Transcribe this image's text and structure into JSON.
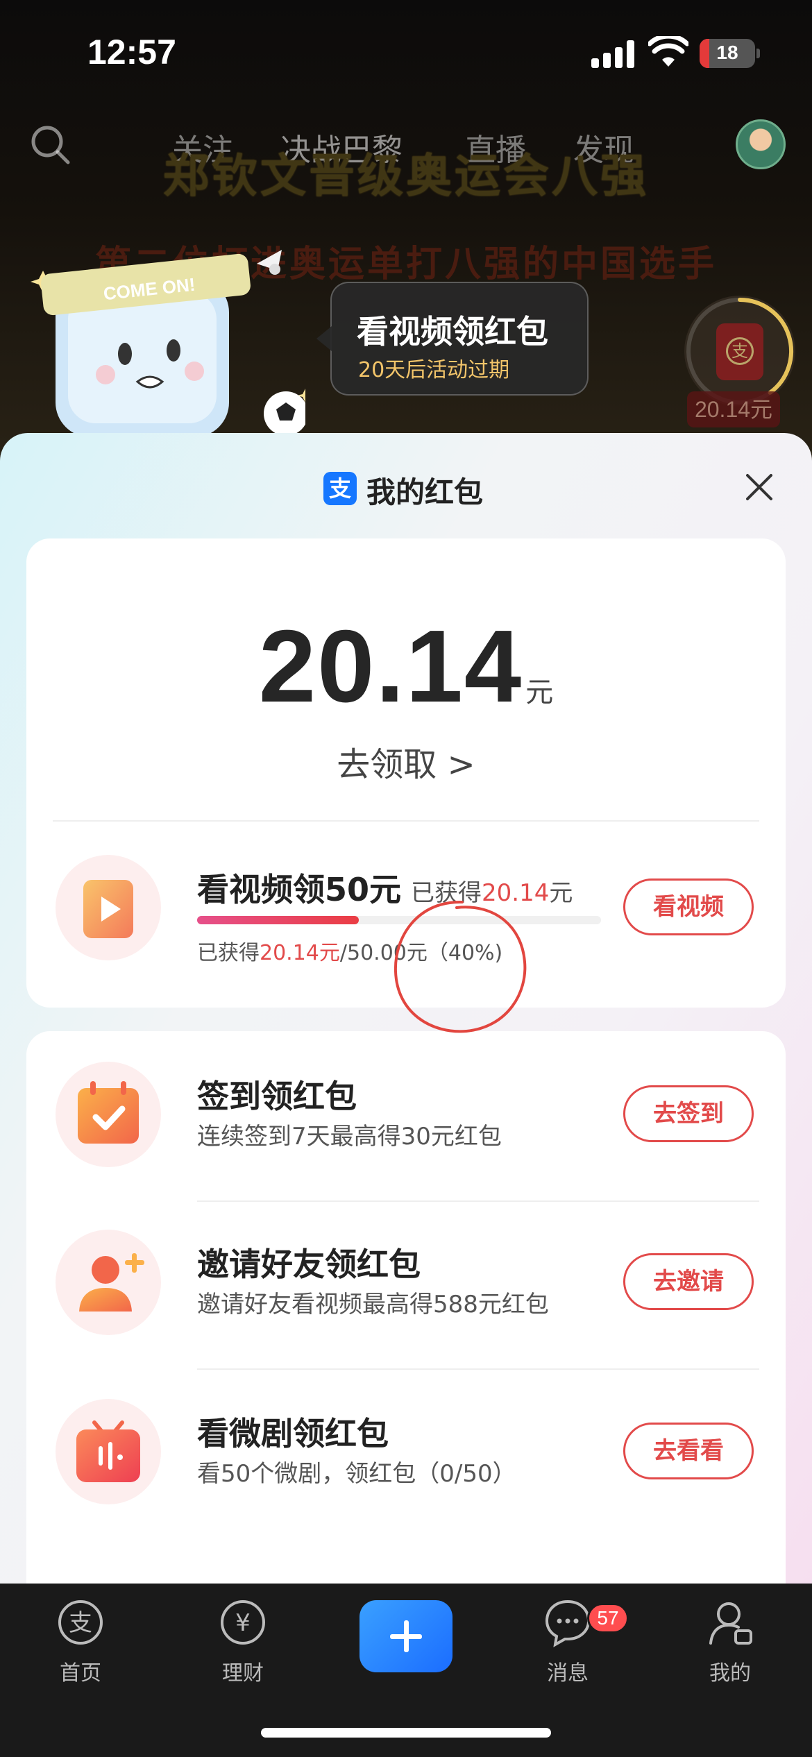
{
  "status_bar": {
    "time": "12:57",
    "battery": "18",
    "battery_fraction": 0.18
  },
  "top_nav": {
    "tabs": [
      "关注",
      "决战巴黎",
      "直播",
      "发现"
    ]
  },
  "video": {
    "title": "郑钦文晋级奥运会八强",
    "subtitle": "第二位打进奥运单打八强的中国选手"
  },
  "mascot": {
    "band_text": "COME ON!"
  },
  "promo_bubble": {
    "title": "看视频领红包",
    "subtitle": "20天后活动过期"
  },
  "redpacket_widget": {
    "amount": "20.14元",
    "icon_char": "支"
  },
  "sheet": {
    "logo_char": "支",
    "title": "我的红包",
    "balance": {
      "amount": "20.14",
      "unit": "元",
      "claim_label": "去领取 >"
    },
    "video_task": {
      "title": "看视频领50元",
      "earned_prefix": "已获得",
      "earned_value": "20.14",
      "earned_suffix": "元",
      "progress_prefix": "已获得",
      "progress_value": "20.14元",
      "progress_total": "/50.00元（40%)",
      "progress_fraction": 0.4,
      "button": "看视频"
    },
    "tasks": [
      {
        "title": "签到领红包",
        "desc": "连续签到7天最高得30元红包",
        "button": "去签到",
        "icon": "calendar-check-icon"
      },
      {
        "title": "邀请好友领红包",
        "desc": "邀请好友看视频最高得588元红包",
        "button": "去邀请",
        "icon": "add-friend-icon"
      },
      {
        "title": "看微剧领红包",
        "desc": "看50个微剧，领红包（0/50）",
        "button": "去看看",
        "icon": "tv-drama-icon"
      }
    ]
  },
  "tab_bar": {
    "tabs": [
      "首页",
      "理财",
      "消息",
      "我的"
    ],
    "message_badge": "57",
    "accent": "#1b6dff"
  },
  "colors": {
    "accent_red": "#e24a4a",
    "brand_blue": "#1677ff"
  }
}
